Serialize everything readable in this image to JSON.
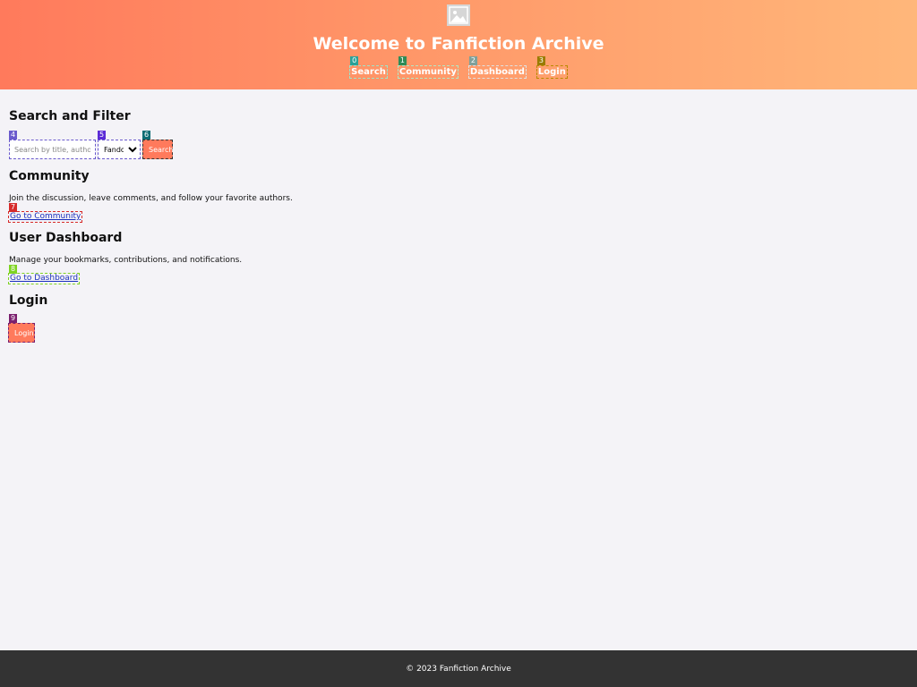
{
  "header": {
    "logo_icon": "image-placeholder-icon",
    "title": "Welcome to Fanfiction Archive",
    "nav": [
      {
        "tag": "0",
        "label": "Search",
        "tag_color": "#2aa198",
        "border": "#9fe3c8"
      },
      {
        "tag": "1",
        "label": "Community",
        "tag_color": "#2e8b57",
        "border": "#b4e6c2"
      },
      {
        "tag": "2",
        "label": "Dashboard",
        "tag_color": "#7fa09a",
        "border": "#e0e0e0"
      },
      {
        "tag": "3",
        "label": "Login",
        "tag_color": "#9a7b00",
        "border": "#b88a00"
      }
    ]
  },
  "search": {
    "heading": "Search and Filter",
    "input_tag": "4",
    "input_placeholder": "Search by title, author, or",
    "select_tag": "5",
    "select_value": "Fandom",
    "button_tag": "6",
    "button_label": "Search"
  },
  "community": {
    "heading": "Community",
    "description": "Join the discussion, leave comments, and follow your favorite authors.",
    "link_tag": "7",
    "link_label": "Go to Community"
  },
  "dashboard": {
    "heading": "User Dashboard",
    "description": "Manage your bookmarks, contributions, and notifications.",
    "link_tag": "8",
    "link_label": "Go to Dashboard"
  },
  "login": {
    "heading": "Login",
    "button_tag": "9",
    "button_label": "Login"
  },
  "footer": {
    "text": "© 2023 Fanfiction Archive"
  },
  "colors": {
    "header_gradient_start": "#ff7a5c",
    "header_gradient_end": "#ffb77a",
    "accent_button": "#ff7a5c",
    "footer_bg": "#333333",
    "page_bg": "#f4f3f7"
  }
}
